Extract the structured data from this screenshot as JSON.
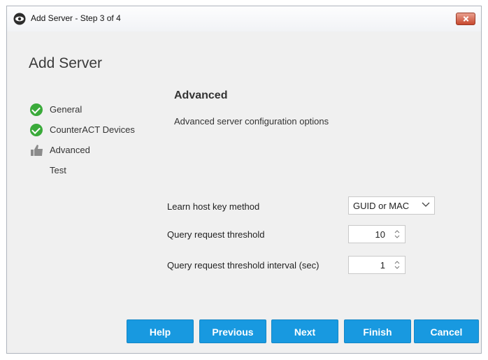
{
  "window": {
    "title": "Add Server - Step 3 of 4",
    "icons": {
      "app": "eye-logo-icon",
      "close": "close-icon"
    }
  },
  "page_title": "Add Server",
  "steps": [
    {
      "label": "General",
      "status": "complete",
      "icon": "check-circle-icon"
    },
    {
      "label": "CounterACT Devices",
      "status": "complete",
      "icon": "check-circle-icon"
    },
    {
      "label": "Advanced",
      "status": "current",
      "icon": "thumbs-up-icon"
    },
    {
      "label": "Test",
      "status": "pending",
      "icon": ""
    }
  ],
  "section": {
    "title": "Advanced",
    "description": "Advanced server configuration options"
  },
  "fields": {
    "learn_host_key_method": {
      "label": "Learn host key method",
      "value": "GUID or MAC"
    },
    "query_request_threshold": {
      "label": "Query request threshold",
      "value": "10"
    },
    "query_request_threshold_interval": {
      "label": "Query request threshold interval (sec)",
      "value": "1"
    }
  },
  "buttons": {
    "help": "Help",
    "previous": "Previous",
    "next": "Next",
    "finish": "Finish",
    "cancel": "Cancel"
  },
  "colors": {
    "button": "#1899e0",
    "check": "#3aaa3a",
    "close": "#c7482e"
  }
}
